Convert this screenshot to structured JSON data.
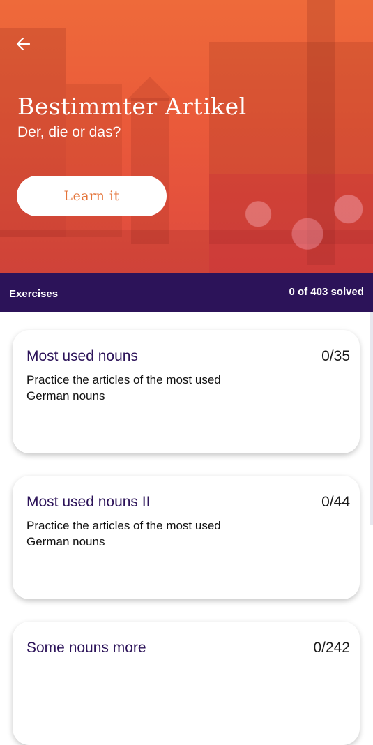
{
  "header": {
    "title": "Bestimmter Artikel",
    "subtitle": "Der, die or das?",
    "learn_button": "Learn it",
    "back_icon": "arrow-left-icon"
  },
  "colors": {
    "hero_overlay": "#ea5a3a",
    "bar_bg": "#2c1359",
    "accent_text": "#e4743a",
    "card_title": "#2c1359"
  },
  "exercises_bar": {
    "label": "Exercises",
    "solved": "0 of 403 solved"
  },
  "cards": [
    {
      "title": "Most used nouns",
      "count": "0/35",
      "description": "Practice the articles of the most used German nouns"
    },
    {
      "title": "Most used nouns II",
      "count": "0/44",
      "description": "Practice the articles of the most used German nouns"
    },
    {
      "title": "Some nouns more",
      "count": "0/242",
      "description": ""
    }
  ]
}
